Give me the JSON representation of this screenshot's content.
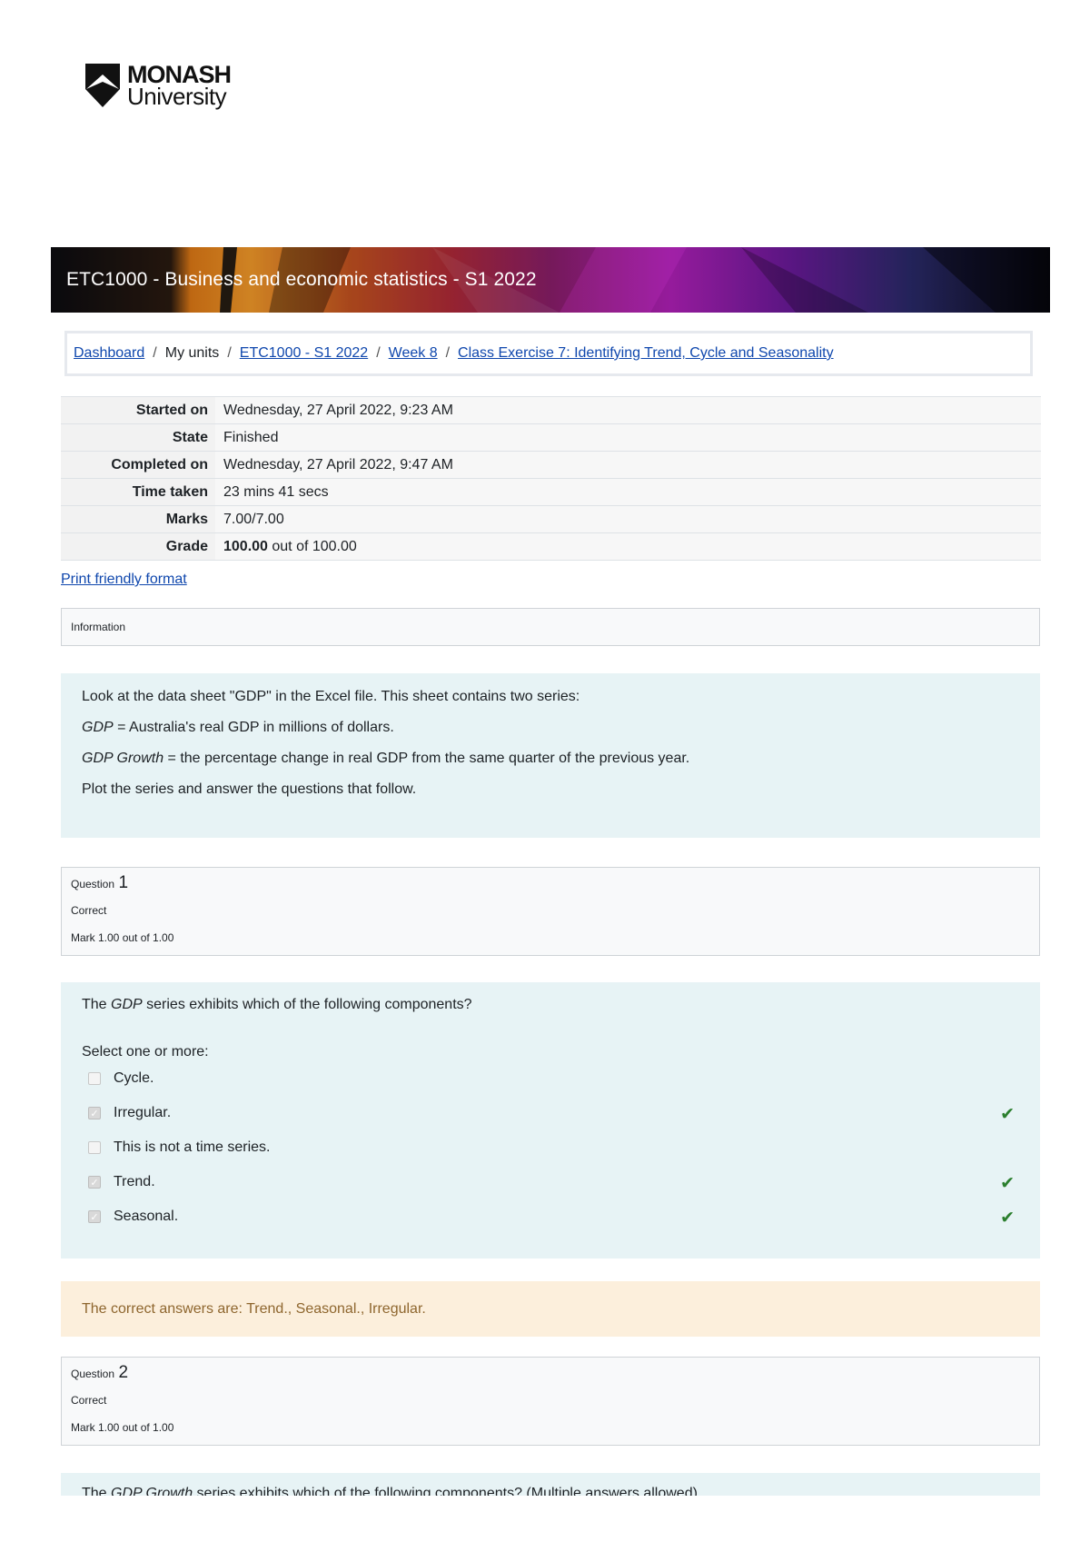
{
  "logo": {
    "line1": "MONASH",
    "line2": "University"
  },
  "banner": {
    "title": "ETC1000 - Business and economic statistics - S1 2022"
  },
  "breadcrumb": {
    "dashboard": "Dashboard",
    "my_units": "My units",
    "unit": "ETC1000 - S1 2022",
    "week": "Week 8",
    "exercise": "Class Exercise 7: Identifying Trend, Cycle and Seasonality",
    "separator": "/"
  },
  "summary": {
    "started_label": "Started on",
    "started_value": "Wednesday, 27 April 2022, 9:23 AM",
    "state_label": "State",
    "state_value": "Finished",
    "completed_label": "Completed on",
    "completed_value": "Wednesday, 27 April 2022, 9:47 AM",
    "time_label": "Time taken",
    "time_value": "23 mins 41 secs",
    "marks_label": "Marks",
    "marks_value": "7.00/7.00",
    "grade_label": "Grade",
    "grade_bold": "100.00",
    "grade_rest": " out of 100.00"
  },
  "print_link": "Print friendly format",
  "info": {
    "label": "Information",
    "line1": "Look at the data sheet \"GDP\" in the Excel file. This sheet contains two series:",
    "line2_em": "GDP",
    "line2_rest": " = Australia's real GDP in millions of dollars.",
    "line3_em": "GDP Growth",
    "line3_rest": " = the percentage change in real GDP from the same quarter of the previous year.",
    "line4": "Plot the series and answer the questions that follow."
  },
  "q1": {
    "label": "Question",
    "number": "1",
    "status": "Correct",
    "mark": "Mark 1.00 out of 1.00",
    "text_pre": "The ",
    "text_em": "GDP",
    "text_post": " series exhibits which of the following components?",
    "prompt": "Select one or more:",
    "answers": [
      {
        "label": "Cycle.",
        "checked": false,
        "correct": false
      },
      {
        "label": "Irregular.",
        "checked": true,
        "correct": true
      },
      {
        "label": "This is not a time series.",
        "checked": false,
        "correct": false
      },
      {
        "label": "Trend.",
        "checked": true,
        "correct": true
      },
      {
        "label": "Seasonal.",
        "checked": true,
        "correct": true
      }
    ],
    "feedback": "The correct answers are: Trend., Seasonal., Irregular."
  },
  "q2": {
    "label": "Question",
    "number": "2",
    "status": "Correct",
    "mark": "Mark 1.00 out of 1.00",
    "text_pre": "The ",
    "text_em": "GDP Growth",
    "text_post": " series exhibits which of the following components? (Multiple answers allowed)"
  },
  "colors": {
    "link": "#0f47ad",
    "correct": "#2b7f2e",
    "panel": "#e7f3f5",
    "feedback": "#fcefdc"
  },
  "icons": {
    "correct": "check-icon",
    "checkbox": "checkbox-icon",
    "logo": "shield-logo"
  }
}
